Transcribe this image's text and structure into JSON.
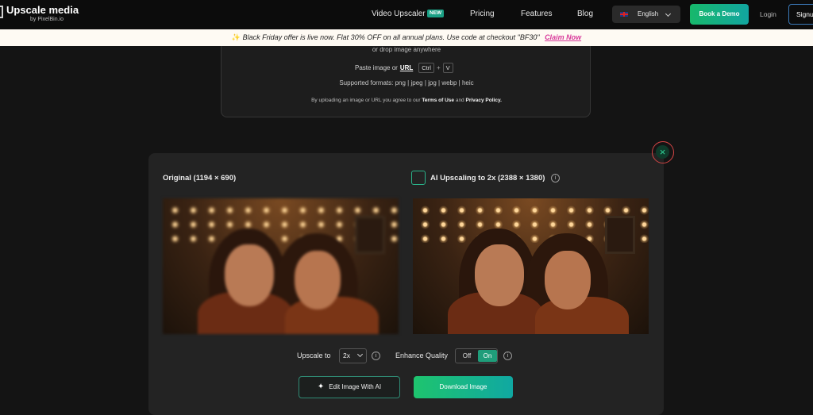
{
  "nav": {
    "logo_title": "Upscale media",
    "logo_sub": "by PixelBin.io",
    "links": [
      "Video Upscaler",
      "Pricing",
      "Features",
      "Blog"
    ],
    "new_badge": "NEW",
    "language": "English",
    "book_demo": "Book a Demo",
    "login": "Login",
    "signup": "Signu"
  },
  "promo": {
    "text": "Black Friday offer is live now. Flat 30% OFF on all annual plans. Use code at checkout \"BF30\"",
    "claim": "Claim Now"
  },
  "upload": {
    "drop_text": "or drop image anywhere",
    "paste_text": "Paste image or",
    "url_label": "URL",
    "key_ctrl": "Ctrl",
    "plus": "+",
    "key_v": "V",
    "formats": "Supported formats:  png | jpeg | jpg | webp | heic",
    "terms_prefix": "By uploading an image or URL you agree to our",
    "terms_link": "Terms of Use",
    "terms_and": "and",
    "privacy_link": "Privacy Policy."
  },
  "compare": {
    "original_label": "Original (1194 × 690)",
    "upscaled_label": "AI Upscaling to 2x (2388 × 1380)",
    "info_glyph": "i"
  },
  "controls": {
    "upscale_label": "Upscale to",
    "upscale_value": "2x",
    "enhance_label": "Enhance Quality",
    "off_label": "Off",
    "on_label": "On",
    "edit_button": "Edit Image With AI",
    "download_button": "Download Image",
    "close_glyph": "×"
  },
  "icons": {
    "close": "close-icon",
    "upscale": "upscale-icon",
    "sparkle": "sparkle-icon",
    "info": "info-icon",
    "chevron": "chevron-down-icon",
    "flag": "uk-flag-icon"
  },
  "colors": {
    "accent": "#1aa085",
    "promo_link": "#d8379a",
    "close_border": "#d44545"
  }
}
